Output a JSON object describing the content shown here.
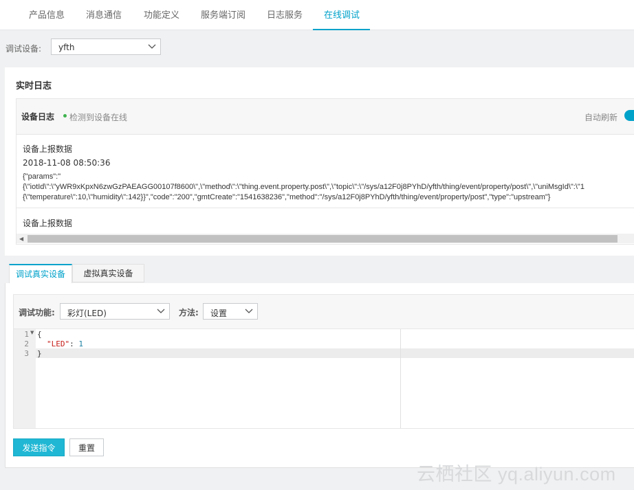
{
  "top_tabs": [
    {
      "label": "产品信息",
      "active": false
    },
    {
      "label": "消息通信",
      "active": false
    },
    {
      "label": "功能定义",
      "active": false
    },
    {
      "label": "服务端订阅",
      "active": false
    },
    {
      "label": "日志服务",
      "active": false
    },
    {
      "label": "在线调试",
      "active": true
    }
  ],
  "device": {
    "label": "调试设备:",
    "selected": "yfth"
  },
  "realtime_log": {
    "title": "实时日志",
    "header": {
      "title": "设备日志",
      "status": "检测到设备在线",
      "auto_refresh_label": "自动刷新",
      "auto_refresh_on": true
    },
    "entries": [
      {
        "title": "设备上报数据",
        "time": "2018-11-08 08:50:36",
        "payload_lines": [
          "{\"params\":\"",
          "{\\\"iotId\\\":\\\"yWR9xKpxN6zwGzPAEAGG00107f8600\\\",\\\"method\\\":\\\"thing.event.property.post\\\",\\\"topic\\\":\\\"/sys/a12F0j8PYhD/yfth/thing/event/property/post\\\",\\\"uniMsgId\\\":\\\"1",
          "{\\\"temperature\\\":10,\\\"humidity\\\":142}}\",\"code\":\"200\",\"gmtCreate\":\"1541638236\",\"method\":\"/sys/a12F0j8PYhD/yfth/thing/event/property/post\",\"type\":\"upstream\"}"
        ]
      },
      {
        "title": "设备上报数据"
      }
    ]
  },
  "debug_tabs": [
    {
      "label": "调试真实设备",
      "active": true
    },
    {
      "label": "虚拟真实设备",
      "active": false
    }
  ],
  "debug": {
    "function_label": "调试功能:",
    "function_value": "彩灯(LED)",
    "method_label": "方法:",
    "method_value": "设置",
    "editor": {
      "line_numbers": [
        "1",
        "2",
        "3"
      ],
      "lines": [
        {
          "text": "{"
        },
        {
          "key": "\"LED\"",
          "sep": ": ",
          "value": "1"
        },
        {
          "text": "}"
        }
      ]
    },
    "send_button": "发送指令",
    "reset_button": "重置"
  },
  "watermark": "云栖社区 yq.aliyun.com",
  "colors": {
    "accent": "#00a2ca",
    "primary_button": "#1fb7d4",
    "online_dot": "#3fb34f"
  }
}
